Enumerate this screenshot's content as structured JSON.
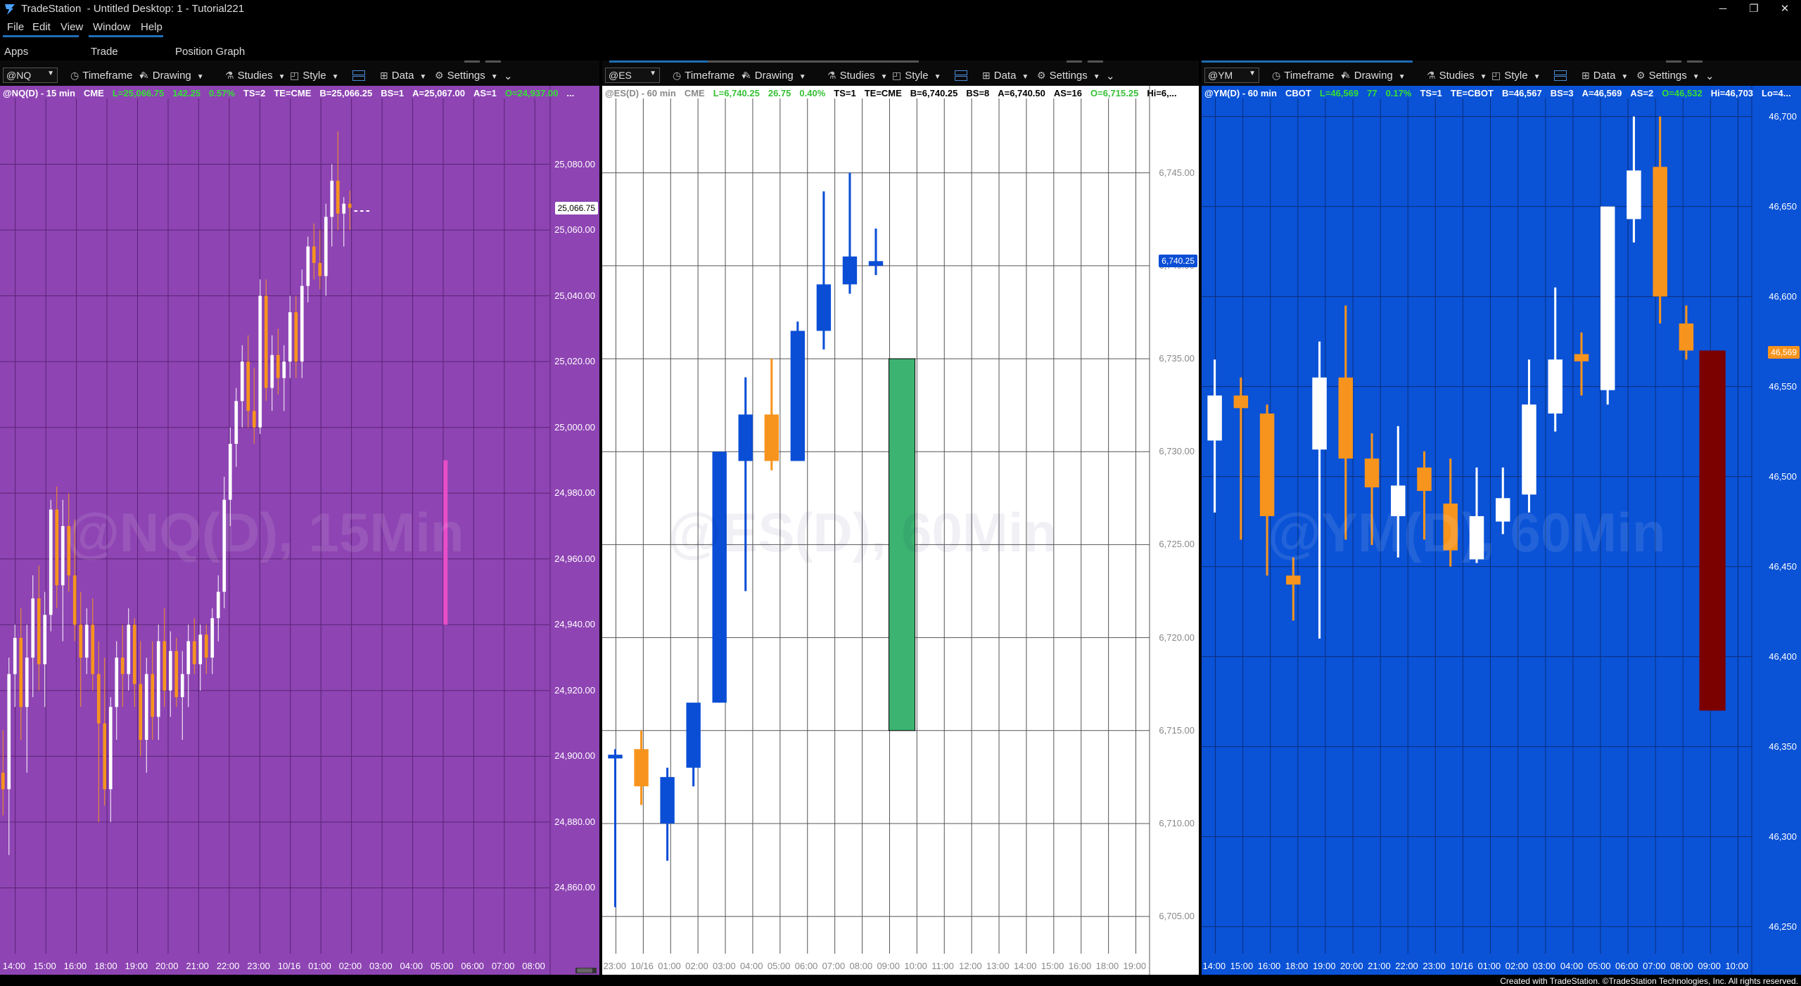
{
  "window": {
    "title": "TradeStation  - Untitled Desktop: 1 - Tutorial221",
    "minimize": "─",
    "restore": "❐",
    "close": "✕"
  },
  "menu": [
    "File",
    "Edit",
    "View",
    "Window",
    "Help"
  ],
  "appbar": [
    "Apps",
    "Trade",
    "Position Graph"
  ],
  "toolbar": {
    "timeframe": "Timeframe",
    "drawing": "Drawing",
    "studies": "Studies",
    "style": "Style",
    "data": "Data",
    "settings": "Settings"
  },
  "footer": "Created with TradeStation. ©TradeStation Technologies, Inc. All rights reserved.",
  "charts": [
    {
      "symbol": "@NQ",
      "bg": "#8e44b3",
      "grid": "#5a2375",
      "up": "#ffffff",
      "down": "#f7941d",
      "axis_text": "#ffffff",
      "watermark": "@NQ(D), 15Min",
      "watermark_color": "rgba(255,255,255,0.10)",
      "quote": [
        {
          "t": "@NQ(D) - 15 min",
          "c": "#ffffff"
        },
        {
          "t": "CME",
          "c": "#ffffff"
        },
        {
          "t": "L=25,066.75",
          "c": "#35e035"
        },
        {
          "t": "142.25",
          "c": "#35e035"
        },
        {
          "t": "0.57%",
          "c": "#35e035"
        },
        {
          "t": "TS=2",
          "c": "#ffffff"
        },
        {
          "t": "TE=CME",
          "c": "#ffffff"
        },
        {
          "t": "B=25,066.25",
          "c": "#ffffff"
        },
        {
          "t": "BS=1",
          "c": "#ffffff"
        },
        {
          "t": "A=25,067.00",
          "c": "#ffffff"
        },
        {
          "t": "AS=1",
          "c": "#ffffff"
        },
        {
          "t": "O=24,937.00",
          "c": "#35e035"
        },
        {
          "t": "...",
          "c": "#ffffff"
        }
      ],
      "ylim": [
        24840,
        25100
      ],
      "yticks": [
        "25,080.00",
        "25,060.00",
        "25,040.00",
        "25,020.00",
        "25,000.00",
        "24,980.00",
        "24,960.00",
        "24,940.00",
        "24,920.00",
        "24,900.00",
        "24,880.00",
        "24,860.00"
      ],
      "ytick_values": [
        25080,
        25060,
        25040,
        25020,
        25000,
        24980,
        24960,
        24940,
        24920,
        24900,
        24880,
        24860
      ],
      "price_tag": {
        "text": "25,066.75",
        "value": 25066.75,
        "bg": "#ffffff",
        "fg": "#000000"
      },
      "xlabels": [
        "14:00",
        "15:00",
        "16:00",
        "18:00",
        "19:00",
        "20:00",
        "21:00",
        "22:00",
        "23:00",
        "10/16",
        "01:00",
        "02:00",
        "03:00",
        "04:00",
        "05:00",
        "06:00",
        "07:00",
        "08:00"
      ],
      "nbars": 92,
      "bars": [
        [
          24895,
          24908,
          24882,
          24890
        ],
        [
          24890,
          24930,
          24870,
          24925
        ],
        [
          24925,
          24940,
          24915,
          24936
        ],
        [
          24936,
          24945,
          24905,
          24915
        ],
        [
          24915,
          24940,
          24895,
          24930
        ],
        [
          24930,
          24955,
          24918,
          24948
        ],
        [
          24948,
          24958,
          24920,
          24928
        ],
        [
          24928,
          24950,
          24915,
          24943
        ],
        [
          24943,
          24978,
          24938,
          24975
        ],
        [
          24975,
          24982,
          24945,
          24952
        ],
        [
          24952,
          24978,
          24935,
          24970
        ],
        [
          24970,
          24980,
          24950,
          24955
        ],
        [
          24955,
          24972,
          24935,
          24940
        ],
        [
          24940,
          24950,
          24915,
          24930
        ],
        [
          24930,
          24945,
          24925,
          24940
        ],
        [
          24940,
          24948,
          24920,
          24925
        ],
        [
          24925,
          24935,
          24880,
          24910
        ],
        [
          24910,
          24930,
          24885,
          24890
        ],
        [
          24890,
          24918,
          24880,
          24915
        ],
        [
          24915,
          24935,
          24905,
          24930
        ],
        [
          24930,
          24940,
          24915,
          24925
        ],
        [
          24925,
          24945,
          24920,
          24940
        ],
        [
          24940,
          24942,
          24915,
          24922
        ],
        [
          24922,
          24935,
          24900,
          24905
        ],
        [
          24905,
          24930,
          24895,
          24925
        ],
        [
          24925,
          24935,
          24905,
          24912
        ],
        [
          24912,
          24940,
          24905,
          24935
        ],
        [
          24935,
          24945,
          24915,
          24920
        ],
        [
          24920,
          24938,
          24912,
          24932
        ],
        [
          24932,
          24936,
          24915,
          24918
        ],
        [
          24918,
          24932,
          24905,
          24925
        ],
        [
          24925,
          24940,
          24915,
          24935
        ],
        [
          24935,
          24942,
          24925,
          24928
        ],
        [
          24928,
          24940,
          24920,
          24937
        ],
        [
          24937,
          24940,
          24925,
          24930
        ],
        [
          24930,
          24945,
          24925,
          24942
        ],
        [
          24942,
          24955,
          24935,
          24950
        ],
        [
          24950,
          24985,
          24945,
          24978
        ],
        [
          24978,
          25000,
          24970,
          24995
        ],
        [
          24995,
          25012,
          24988,
          25008
        ],
        [
          25008,
          25025,
          25000,
          25020
        ],
        [
          25020,
          25028,
          25000,
          25005
        ],
        [
          25005,
          25018,
          24995,
          25000
        ],
        [
          25000,
          25045,
          24998,
          25040
        ],
        [
          25040,
          25045,
          25008,
          25012
        ],
        [
          25012,
          25028,
          25005,
          25022
        ],
        [
          25022,
          25030,
          25010,
          25015
        ],
        [
          25015,
          25025,
          25005,
          25020
        ],
        [
          25020,
          25040,
          25015,
          25035
        ],
        [
          25035,
          25040,
          25015,
          25020
        ],
        [
          25020,
          25048,
          25015,
          25043
        ],
        [
          25043,
          25058,
          25038,
          25055
        ],
        [
          25055,
          25062,
          25045,
          25050
        ],
        [
          25050,
          25060,
          25042,
          25046
        ],
        [
          25046,
          25068,
          25040,
          25064
        ],
        [
          25064,
          25080,
          25055,
          25075
        ],
        [
          25075,
          25090,
          25060,
          25065
        ],
        [
          25065,
          25070,
          25055,
          25068
        ],
        [
          25068,
          25072,
          25060,
          25066.75
        ],
        [
          25066,
          25066,
          25066,
          25066
        ],
        [
          25066,
          25066,
          25066,
          25066
        ],
        [
          25066,
          25066,
          25066,
          25066
        ]
      ],
      "bar_start": 0,
      "box": {
        "bar": 74,
        "top": 24990,
        "bottom": 24940,
        "color": "#e84ec8",
        "w": 0.5
      }
    },
    {
      "symbol": "@ES",
      "bg": "#ffffff",
      "grid": "#555555",
      "up": "#0a4ed6",
      "down": "#f7941d",
      "axis_text": "#888888",
      "watermark": "@ES(D), 60Min",
      "watermark_color": "rgba(0,0,80,0.06)",
      "quote": [
        {
          "t": "@ES(D) - 60 min",
          "c": "#888888"
        },
        {
          "t": "CME",
          "c": "#888888"
        },
        {
          "t": "L=6,740.25",
          "c": "#35c035"
        },
        {
          "t": "26.75",
          "c": "#35c035"
        },
        {
          "t": "0.40%",
          "c": "#35c035"
        },
        {
          "t": "TS=1",
          "c": "#000000"
        },
        {
          "t": "TE=CME",
          "c": "#000000"
        },
        {
          "t": "B=6,740.25",
          "c": "#000000"
        },
        {
          "t": "BS=8",
          "c": "#000000"
        },
        {
          "t": "A=6,740.50",
          "c": "#000000"
        },
        {
          "t": "AS=16",
          "c": "#000000"
        },
        {
          "t": "O=6,715.25",
          "c": "#35c035"
        },
        {
          "t": "Hi=6,...",
          "c": "#000000"
        }
      ],
      "ylim": [
        6703,
        6749
      ],
      "yticks": [
        "6,745.00",
        "6,740.00",
        "6,735.00",
        "6,730.00",
        "6,725.00",
        "6,720.00",
        "6,715.00",
        "6,710.00",
        "6,705.00"
      ],
      "ytick_values": [
        6745,
        6740,
        6735,
        6730,
        6725,
        6720,
        6715,
        6710,
        6705
      ],
      "price_tag": {
        "text": "6,740.25",
        "value": 6740.25,
        "bg": "#0a4ed6",
        "fg": "#ffffff"
      },
      "xlabels": [
        "23:00",
        "10/16",
        "01:00",
        "02:00",
        "03:00",
        "04:00",
        "05:00",
        "06:00",
        "07:00",
        "08:00",
        "09:00",
        "10:00",
        "11:00",
        "12:00",
        "13:00",
        "14:00",
        "15:00",
        "16:00",
        "18:00",
        "19:00"
      ],
      "nbars": 21,
      "bars": [
        [
          6713.5,
          6714,
          6705.5,
          6713.7
        ],
        [
          6714,
          6715,
          6711,
          6712
        ],
        [
          6710,
          6713,
          6708,
          6712.5
        ],
        [
          6713,
          6716,
          6712,
          6716.5
        ],
        [
          6716.5,
          6730,
          6716.5,
          6730
        ],
        [
          6729.5,
          6734,
          6722.5,
          6732
        ],
        [
          6732,
          6735,
          6729,
          6729.5
        ],
        [
          6729.5,
          6737,
          6729.5,
          6736.5
        ],
        [
          6736.5,
          6744,
          6735.5,
          6739
        ],
        [
          6739,
          6745,
          6738.5,
          6740.5
        ],
        [
          6740,
          6742,
          6739.5,
          6740.25
        ]
      ],
      "bar_start": 0,
      "box": {
        "bar": 11,
        "top": 6735,
        "bottom": 6715,
        "color": "#3cb371",
        "w": 1.0
      }
    },
    {
      "symbol": "@YM",
      "bg": "#0a52d6",
      "grid": "#0a2f7a",
      "up": "#ffffff",
      "down": "#f7941d",
      "axis_text": "#ffffff",
      "watermark": "@YM(D), 60Min",
      "watermark_color": "rgba(255,255,255,0.10)",
      "quote": [
        {
          "t": "@YM(D) - 60 min",
          "c": "#ffffff"
        },
        {
          "t": "CBOT",
          "c": "#ffffff"
        },
        {
          "t": "L=46,569",
          "c": "#35e035"
        },
        {
          "t": "77",
          "c": "#35e035"
        },
        {
          "t": "0.17%",
          "c": "#35e035"
        },
        {
          "t": "TS=1",
          "c": "#ffffff"
        },
        {
          "t": "TE=CBOT",
          "c": "#ffffff"
        },
        {
          "t": "B=46,567",
          "c": "#ffffff"
        },
        {
          "t": "BS=3",
          "c": "#ffffff"
        },
        {
          "t": "A=46,569",
          "c": "#ffffff"
        },
        {
          "t": "AS=2",
          "c": "#ffffff"
        },
        {
          "t": "O=46,532",
          "c": "#35e035"
        },
        {
          "t": "Hi=46,703",
          "c": "#ffffff"
        },
        {
          "t": "Lo=4...",
          "c": "#ffffff"
        }
      ],
      "ylim": [
        46235,
        46710
      ],
      "yticks": [
        "46,700",
        "46,650",
        "46,600",
        "46,550",
        "46,500",
        "46,450",
        "46,400",
        "46,350",
        "46,300",
        "46,250"
      ],
      "ytick_values": [
        46700,
        46650,
        46600,
        46550,
        46500,
        46450,
        46400,
        46350,
        46300,
        46250
      ],
      "price_tag": {
        "text": "46,569",
        "value": 46569,
        "bg": "#f7941d",
        "fg": "#ffffff"
      },
      "xlabels": [
        "14:00",
        "15:00",
        "16:00",
        "18:00",
        "19:00",
        "20:00",
        "21:00",
        "22:00",
        "23:00",
        "10/16",
        "01:00",
        "02:00",
        "03:00",
        "04:00",
        "05:00",
        "06:00",
        "07:00",
        "08:00",
        "09:00",
        "10:00"
      ],
      "nbars": 21,
      "bars": [
        [
          46520,
          46565,
          46480,
          46545
        ],
        [
          46545,
          46555,
          46465,
          46538
        ],
        [
          46535,
          46540,
          46445,
          46478
        ],
        [
          46445,
          46455,
          46420,
          46440
        ],
        [
          46515,
          46575,
          46410,
          46555
        ],
        [
          46555,
          46595,
          46465,
          46510
        ],
        [
          46510,
          46524,
          46462,
          46494
        ],
        [
          46478,
          46528,
          46455,
          46495
        ],
        [
          46505,
          46514,
          46465,
          46492
        ],
        [
          46485,
          46510,
          46450,
          46459
        ],
        [
          46454,
          46505,
          46452,
          46478
        ],
        [
          46475,
          46505,
          46468,
          46488
        ],
        [
          46490,
          46565,
          46480,
          46540
        ],
        [
          46535,
          46605,
          46525,
          46565
        ],
        [
          46568,
          46580,
          46545,
          46564
        ],
        [
          46548,
          46645,
          46540,
          46650
        ],
        [
          46643,
          46700,
          46630,
          46670
        ],
        [
          46672,
          46700,
          46585,
          46600
        ],
        [
          46585,
          46595,
          46565,
          46570
        ]
      ],
      "bar_start": 0,
      "box": {
        "bar": 19,
        "top": 46570,
        "bottom": 46370,
        "color": "#7b0000",
        "w": 1.0
      }
    }
  ]
}
